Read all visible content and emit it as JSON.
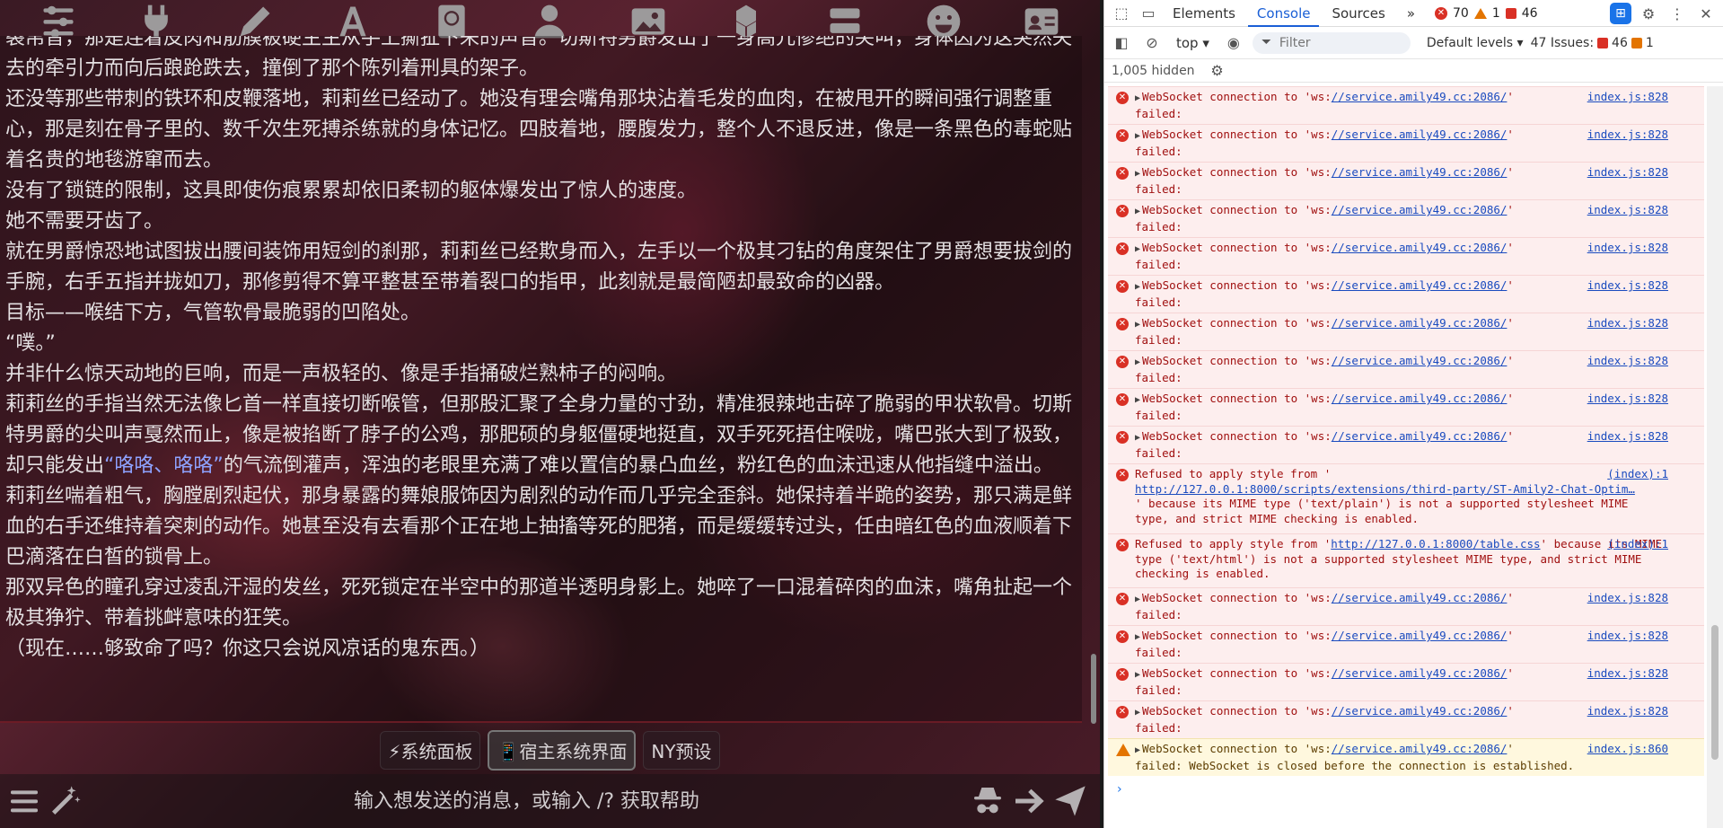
{
  "topbar": {
    "icons": [
      "sliders-icon",
      "plug-icon",
      "pen-icon",
      "font-icon",
      "book-globe-icon",
      "user-icon",
      "image-icon",
      "cubes-icon",
      "server-icon",
      "smiley-icon",
      "id-card-icon"
    ]
  },
  "chat": {
    "paragraphs": [
      "裂帛音，那是连着皮肉和筋膜被硬生生从手上撕扯下来的声音。切斯特男爵发出了一身高亢惨绝的尖叫，身体因为这突然失去的牵引力而向后踉跄跌去，撞倒了那个陈列着刑具的架子。",
      "还没等那些带刺的铁环和皮鞭落地，莉莉丝已经动了。她没有理会嘴角那块沾着毛发的血肉，在被甩开的瞬间强行调整重心，那是刻在骨子里的、数千次生死搏杀练就的身体记忆。四肢着地，腰腹发力，整个人不退反进，像是一条黑色的毒蛇贴着名贵的地毯游窜而去。",
      "没有了锁链的限制，这具即使伤痕累累却依旧柔韧的躯体爆发出了惊人的速度。",
      "她不需要牙齿了。",
      "就在男爵惊恐地试图拔出腰间装饰用短剑的刹那，莉莉丝已经欺身而入，左手以一个极其刁钻的角度架住了男爵想要拔剑的手腕，右手五指并拢如刀，那修剪得不算平整甚至带着裂口的指甲，此刻就是最简陋却最致命的凶器。",
      "目标——喉结下方，气管软骨最脆弱的凹陷处。",
      "“噗。”",
      "并非什么惊天动地的巨响，而是一声极轻的、像是手指捅破烂熟柿子的闷响。",
      "莉莉丝的手指当然无法像匕首一样直接切断喉管，但那股汇聚了全身力量的寸劲，精准狠辣地击碎了脆弱的甲状软骨。切斯特男爵的尖叫声戛然而止，像是被掐断了脖子的公鸡，那肥硕的身躯僵硬地挺直，双手死死捂住喉咙，嘴巴张大到了极致，却只能发出",
      "“咯咯、咯咯”",
      "的气流倒灌声，浑浊的老眼里充满了难以置信的暴凸血丝，粉红色的血沫迅速从他指缝中溢出。",
      "莉莉丝喘着粗气，胸膛剧烈起伏，那身暴露的舞娘服饰因为剧烈的动作而几乎完全歪斜。她保持着半跪的姿势，那只满是鲜血的右手还维持着突刺的动作。她甚至没有去看那个正在地上抽搐等死的肥猪，而是缓缓转过头，任由暗红色的血液顺着下巴滴落在白皙的锁骨上。",
      "那双异色的瞳孔穿过凌乱汗湿的发丝，死死锁定在半空中的那道半透明身影上。她啐了一口混着碎肉的血沫，嘴角扯起一个极其狰狞、带着挑衅意味的狂笑。",
      "（现在……够致命了吗？你这只会说风凉话的鬼东西。）"
    ]
  },
  "quickbar": {
    "buttons": [
      "⚡系统面板",
      "📱宿主系统界面",
      "NY预设"
    ]
  },
  "input": {
    "placeholder": "输入想发送的消息，或输入 /? 获取帮助"
  },
  "devtools": {
    "tabs": [
      "Elements",
      "Console",
      "Sources"
    ],
    "active_tab": "Console",
    "more_tabs": "»",
    "error_count": "70",
    "warn_count": "1",
    "issue_count": "46",
    "context": "top ▾",
    "filter_placeholder": "Filter",
    "levels": "Default levels ▾",
    "issues_label": "47 Issues:",
    "issues_err": "46",
    "issues_warn": "1",
    "hidden": "1,005 hidden",
    "ws_prefix": "WebSocket connection to 'ws:",
    "ws_url": "//service.amily49.cc:2086/",
    "ws_suffix": "'",
    "failed": "failed:",
    "ws_source": "index.js:828",
    "mime1_a": "Refused to apply style from '",
    "mime1_url": "http://127.0.0.1:8000/scripts/extensions/third-party/ST-Amily2-Chat-Optim…",
    "mime1_b": "' because its MIME type ('text/plain') is not a supported stylesheet MIME type, and strict MIME checking is enabled.",
    "mime2_a": "Refused to apply style from '",
    "mime2_url": "http://127.0.0.1:8000/table.css",
    "mime2_b": "' because its MIME type ('text/html') is not a supported stylesheet MIME type, and strict MIME checking is enabled.",
    "index_source": "(index):1",
    "warn_failed": "failed: WebSocket is closed before the connection is established.",
    "warn_source": "index.js:860",
    "prompt": "›"
  },
  "colors": {
    "quote": "#8ea2ff",
    "error_bg": "#fdeeee",
    "warn_bg": "#fff8de",
    "devtools_accent": "#1a5fd6"
  }
}
